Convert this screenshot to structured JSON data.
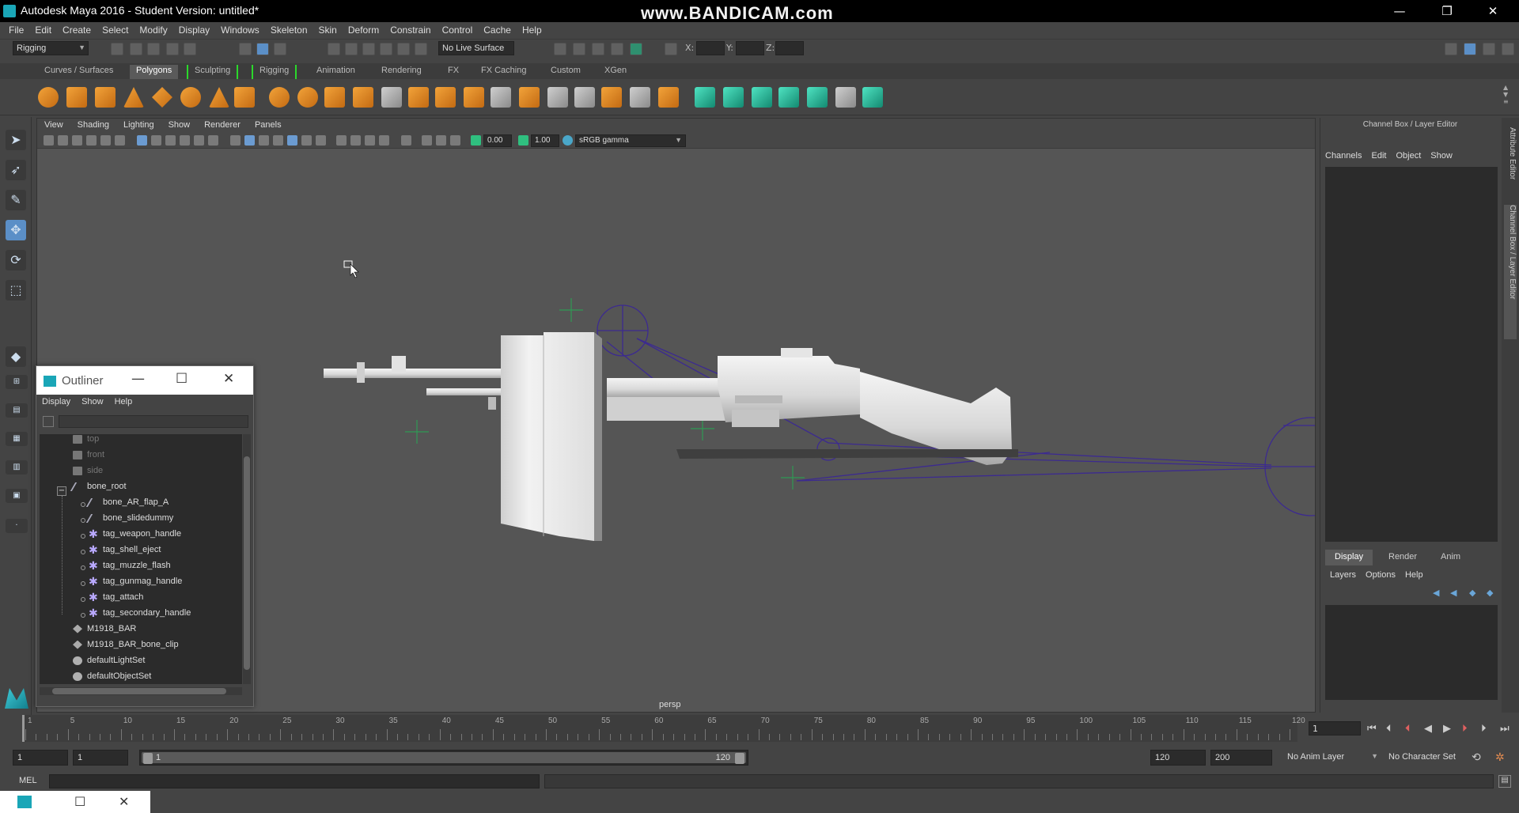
{
  "window": {
    "title": "Autodesk Maya 2016 - Student Version: untitled*",
    "watermark": "www.BANDICAM.com",
    "minimize": "—",
    "restore": "❐",
    "close": "✕"
  },
  "menubar": [
    "File",
    "Edit",
    "Create",
    "Select",
    "Modify",
    "Display",
    "Windows",
    "Skeleton",
    "Skin",
    "Deform",
    "Constrain",
    "Control",
    "Cache",
    "Help"
  ],
  "statusline": {
    "menuset": "Rigging",
    "live_surface": "No Live Surface",
    "x_label": "X:",
    "y_label": "Y:",
    "z_label": "Z:"
  },
  "shelf_tabs": [
    {
      "label": "Curves / Surfaces",
      "active": false
    },
    {
      "label": "Polygons",
      "active": true
    },
    {
      "label": "Sculpting",
      "active": false
    },
    {
      "label": "Rigging",
      "active": false
    },
    {
      "label": "Animation",
      "active": false
    },
    {
      "label": "Rendering",
      "active": false
    },
    {
      "label": "FX",
      "active": false
    },
    {
      "label": "FX Caching",
      "active": false
    },
    {
      "label": "Custom",
      "active": false
    },
    {
      "label": "XGen",
      "active": false
    }
  ],
  "viewport": {
    "menu": [
      "View",
      "Shading",
      "Lighting",
      "Show",
      "Renderer",
      "Panels"
    ],
    "exposure": "0.00",
    "gamma": "1.00",
    "color_space": "sRGB gamma",
    "camera": "persp"
  },
  "outliner": {
    "title": "Outliner",
    "menu": [
      "Display",
      "Show",
      "Help"
    ],
    "expander": "−",
    "items": [
      {
        "label": "top",
        "icon": "camera-icon"
      },
      {
        "label": "front",
        "icon": "camera-icon"
      },
      {
        "label": "side",
        "icon": "camera-icon"
      },
      {
        "label": "bone_root",
        "icon": "bone-icon"
      },
      {
        "label": "bone_AR_flap_A",
        "icon": "bone-icon"
      },
      {
        "label": "bone_slidedummy",
        "icon": "bone-icon"
      },
      {
        "label": "tag_weapon_handle",
        "icon": "tag-icon"
      },
      {
        "label": "tag_shell_eject",
        "icon": "tag-icon"
      },
      {
        "label": "tag_muzzle_flash",
        "icon": "tag-icon"
      },
      {
        "label": "tag_gunmag_handle",
        "icon": "tag-icon"
      },
      {
        "label": "tag_attach",
        "icon": "tag-icon"
      },
      {
        "label": "tag_secondary_handle",
        "icon": "tag-icon"
      },
      {
        "label": "M1918_BAR",
        "icon": "mesh-icon"
      },
      {
        "label": "M1918_BAR_bone_clip",
        "icon": "mesh-icon"
      },
      {
        "label": "defaultLightSet",
        "icon": "set-icon"
      },
      {
        "label": "defaultObjectSet",
        "icon": "set-icon"
      }
    ]
  },
  "channelbox": {
    "title": "Channel Box / Layer Editor",
    "menu": [
      "Channels",
      "Edit",
      "Object",
      "Show"
    ],
    "layer_tabs": [
      "Display",
      "Render",
      "Anim"
    ],
    "layer_menu": [
      "Layers",
      "Options",
      "Help"
    ],
    "side_tabs": [
      "Attribute Editor",
      "Channel Box / Layer Editor"
    ]
  },
  "timeline": {
    "ticks": [
      "1",
      "5",
      "10",
      "15",
      "20",
      "25",
      "30",
      "35",
      "40",
      "45",
      "50",
      "55",
      "60",
      "65",
      "70",
      "75",
      "80",
      "85",
      "90",
      "95",
      "100",
      "105",
      "110",
      "115",
      "120"
    ],
    "current_frame": "1"
  },
  "range": {
    "start": "1",
    "playback_start": "1",
    "slider_start": "1",
    "slider_end": "120",
    "playback_end": "120",
    "end": "200",
    "anim_layer": "No Anim Layer",
    "character_set": "No Character Set"
  },
  "cmdline": {
    "label": "MEL"
  }
}
